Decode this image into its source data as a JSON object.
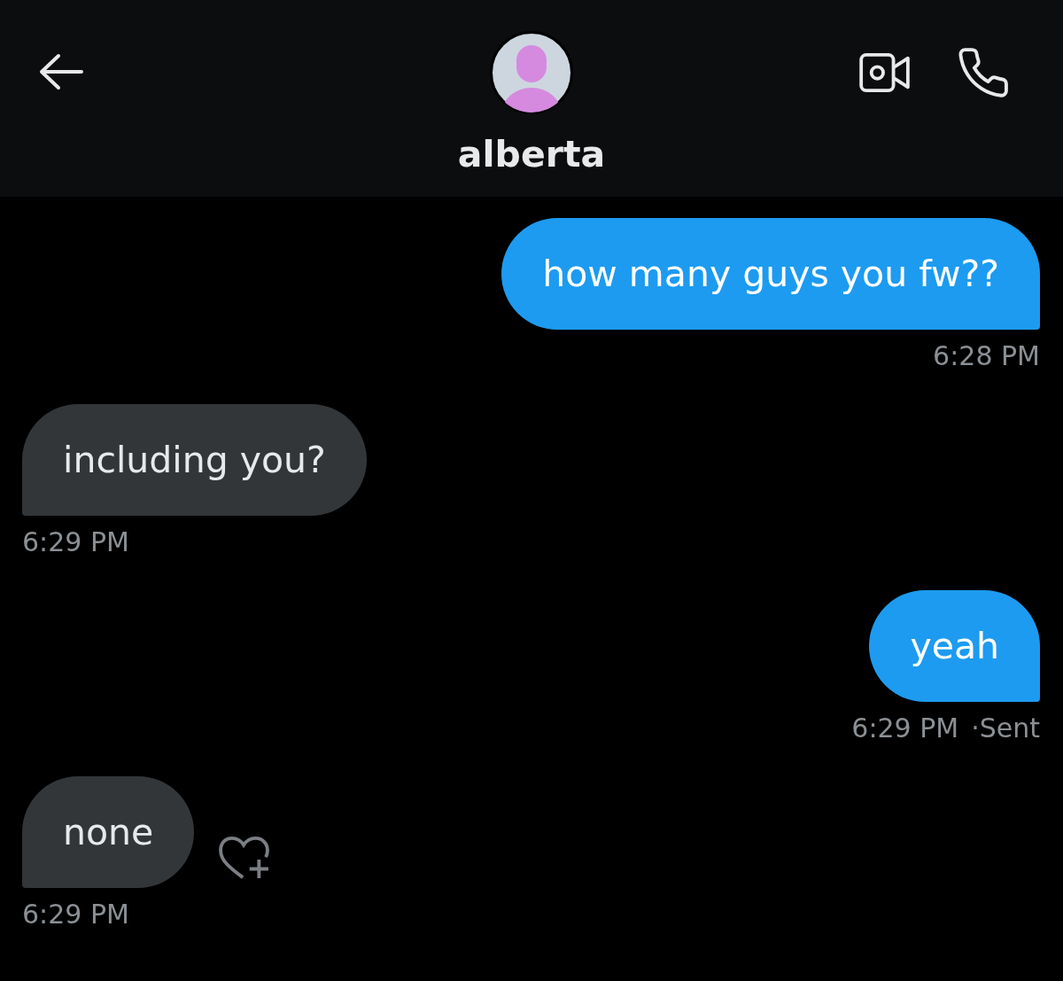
{
  "header": {
    "title": "alberta"
  },
  "messages": [
    {
      "kind": "sent",
      "text": "how many guys you fw??",
      "time": "6:28 PM",
      "react_button": false
    },
    {
      "kind": "received",
      "text": "including you?",
      "time": "6:29 PM",
      "react_button": false
    },
    {
      "kind": "sent",
      "text": "yeah",
      "time": "6:29 PM",
      "status": "·Sent",
      "react_button": false
    },
    {
      "kind": "received",
      "text": "none",
      "time": "6:29 PM",
      "react_button": true
    }
  ]
}
